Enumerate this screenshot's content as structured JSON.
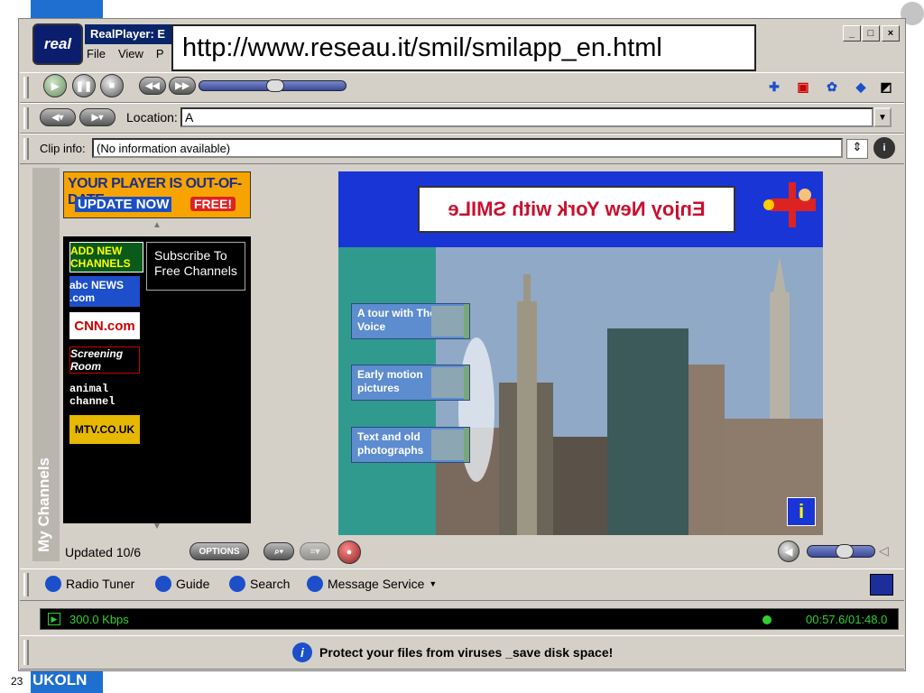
{
  "app": {
    "title": "RealPlayer: E",
    "logo_text": "real",
    "menu": [
      "File",
      "View",
      "P"
    ]
  },
  "overlay_url": "http://www.reseau.it/smil/smilapp_en.html",
  "window_buttons": [
    "_",
    "□",
    "×"
  ],
  "location": {
    "label": "Location:",
    "value": "A"
  },
  "clip_info": {
    "label": "Clip info:",
    "value": "(No information available)"
  },
  "channels": {
    "sidebar_title": "My Channels",
    "ad": {
      "line1": "YOUR PLAYER IS OUT-OF-DATE",
      "line2": "UPDATE NOW",
      "badge": "FREE!"
    },
    "items": [
      {
        "label": "ADD NEW CHANNELS"
      },
      {
        "label": "abc NEWS .com"
      },
      {
        "label": "CNN.com"
      },
      {
        "label": "Screening Room"
      },
      {
        "label": "animal channel"
      },
      {
        "label": "MTV.CO.UK"
      }
    ],
    "tooltip": "Subscribe To Free Channels",
    "updated": "Updated 10/6",
    "options": "OPTIONS"
  },
  "content": {
    "banner": "Enjoy New York with SMILe",
    "menu_items": [
      "A tour with The Voice",
      "Early motion pictures",
      "Text and old photographs"
    ],
    "info_icon": "i"
  },
  "links": [
    "Radio Tuner",
    "Guide",
    "Search",
    "Message Service"
  ],
  "status": {
    "bitrate": "300.0 Kbps",
    "time": "00:57.6/01:48.0"
  },
  "bottom_message": "Protect your files from viruses _save disk space!",
  "slide": {
    "number": "23",
    "brand": "UKOLN"
  },
  "colors": {
    "accent": "#1f6fd0",
    "banner_bg": "#1a35d6",
    "status_green": "#30d030"
  }
}
